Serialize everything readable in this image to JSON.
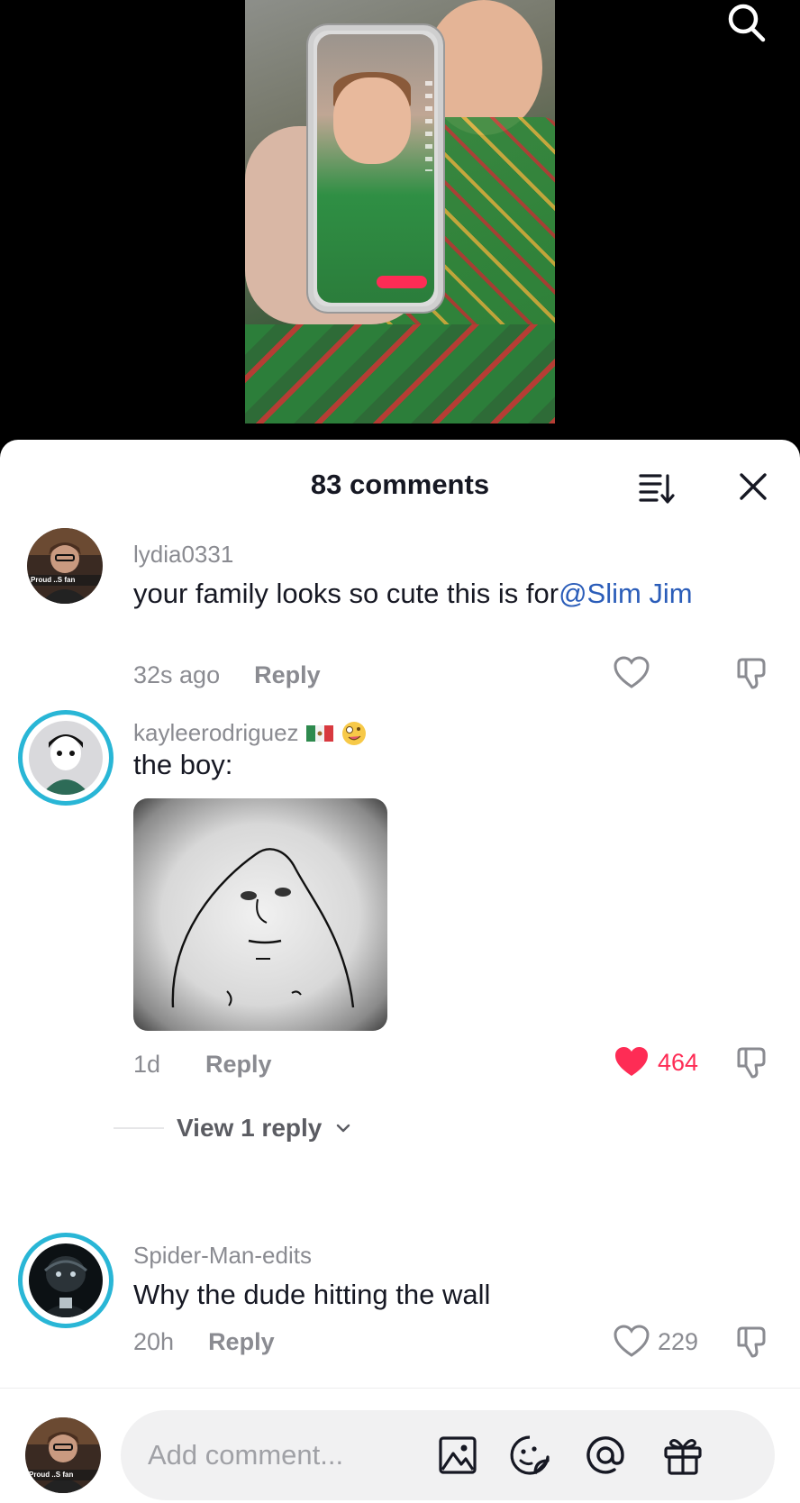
{
  "header": {
    "comment_count_label": "83 comments"
  },
  "comments": [
    {
      "username": "lydia0331",
      "text": "your family looks so cute this is for",
      "mention": "@Slim Jim",
      "time": "32s ago",
      "reply_label": "Reply",
      "avatar_badge": "Proud ..S fan"
    },
    {
      "username": "kayleerodriguez",
      "text": "the boy:",
      "time": "1d",
      "reply_label": "Reply",
      "like_count": "464",
      "liked": true,
      "view_replies_label": "View 1 reply"
    },
    {
      "username": "Spider-Man-edits",
      "text": "Why the dude hitting the wall",
      "time": "20h",
      "reply_label": "Reply",
      "like_count": "229"
    }
  ],
  "input": {
    "placeholder": "Add comment..."
  },
  "colors": {
    "accent": "#fe2c55",
    "mention": "#2b5db9",
    "story_ring": "#29b6d6",
    "muted_text": "#8a8b91"
  },
  "icons": [
    "search-icon",
    "sort-icon",
    "close-icon",
    "heart-icon",
    "dislike-icon",
    "image-icon",
    "emoji-icon",
    "at-icon",
    "gift-icon",
    "chevron-down-icon"
  ]
}
